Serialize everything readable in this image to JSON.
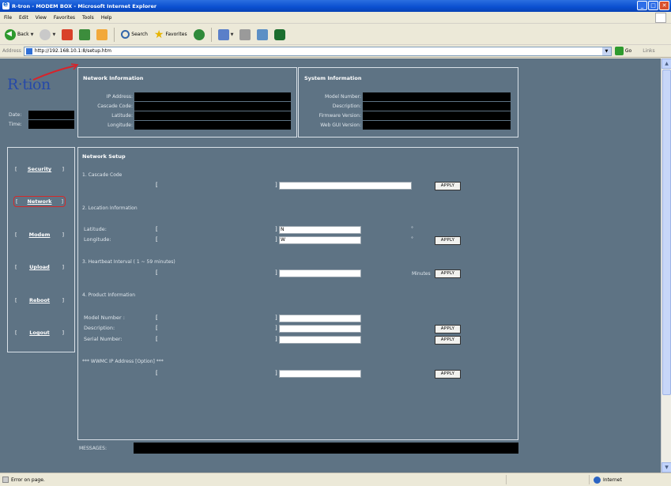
{
  "window": {
    "title": "R-tron - MODEM BOX - Microsoft Internet Explorer",
    "btn_min": "_",
    "btn_max": "□",
    "btn_close": "✕"
  },
  "menu": [
    "File",
    "Edit",
    "View",
    "Favorites",
    "Tools",
    "Help"
  ],
  "toolbar": {
    "back": "Back",
    "search": "Search",
    "favorites": "Favorites"
  },
  "address": {
    "label": "Address",
    "url": "http://192.168.10.1:8/setup.htm",
    "go": "Go",
    "links": "Links"
  },
  "logo": "R·tion",
  "datetime": {
    "date_label": "Date:",
    "time_label": "Time:"
  },
  "network_info": {
    "title": "Network Information",
    "fields": [
      "IP Address:",
      "Cascade Code:",
      "Latitude:",
      "Longitude:"
    ]
  },
  "system_info": {
    "title": "System Information",
    "fields": [
      "Model Number:",
      "Description:",
      "Firmware Version:",
      "Web GUI Version:"
    ]
  },
  "nav": [
    "Security",
    "Network",
    "Modem",
    "Upload",
    "Reboot",
    "Logout"
  ],
  "setup": {
    "title": "Network Setup",
    "s1": "1. Cascade Code",
    "s2": "2. Location Information",
    "latitude_label": "Latitude:",
    "longitude_label": "Longitude:",
    "lat_value": "N",
    "lon_value": "W",
    "s3": "3. Heartbeat Interval ( 1 ~ 59 minutes)",
    "minutes": "Minutes",
    "s4": "4. Product Information",
    "model_label": "Model Number :",
    "desc_label": "Description:",
    "serial_label": "Serial Number:",
    "s5": "*** WWMC IP Address [Option] ***",
    "apply": "APPLY",
    "bracket_open": "[",
    "bracket_close": "]",
    "degree": "°"
  },
  "messages_label": "MESSAGES:",
  "status": {
    "left": "Error on page.",
    "zone": "Internet"
  }
}
